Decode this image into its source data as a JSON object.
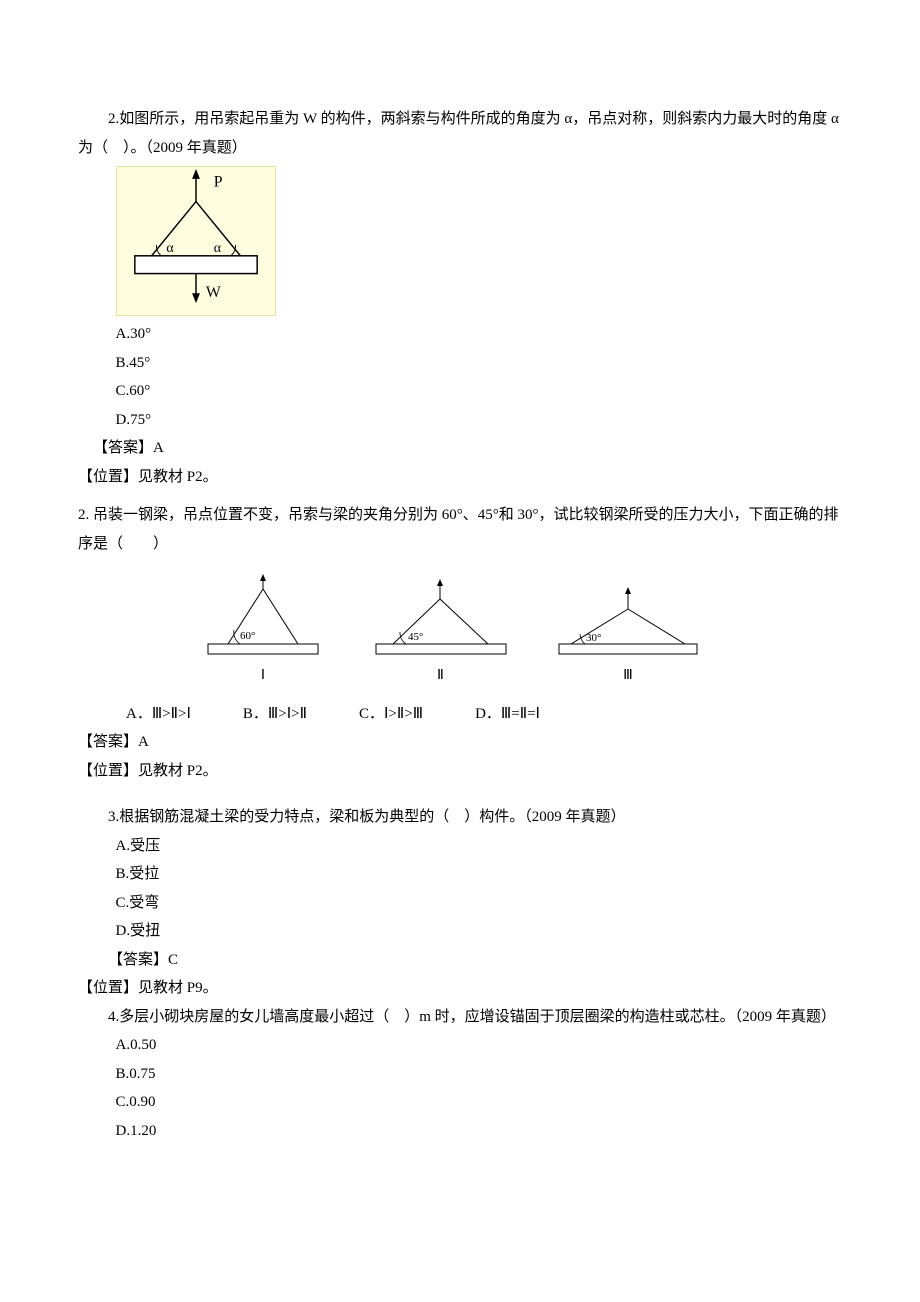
{
  "q2a": {
    "text": "2.如图所示，用吊索起吊重为 W 的构件，两斜索与构件所成的角度为 α，吊点对称，则斜索内力最大时的角度 α 为（　）。（2009 年真题）",
    "optA": "A.30°",
    "optB": "B.45°",
    "optC": "C.60°",
    "optD": "D.75°",
    "answer": "【答案】A",
    "position": "【位置】见教材 P2。",
    "fig": {
      "labelP": "P",
      "labelAlphaL": "α",
      "labelAlphaR": "α",
      "labelW": "W"
    }
  },
  "q2b": {
    "text": "2. 吊装一钢梁，吊点位置不变，吊索与梁的夹角分别为 60°、45°和 30°，试比较钢梁所受的压力大小，下面正确的排序是（　　）",
    "figs": {
      "angle1": "60°",
      "label1": "Ⅰ",
      "angle2": "45°",
      "label2": "Ⅱ",
      "angle3": "30°",
      "label3": "Ⅲ"
    },
    "optA": "A．Ⅲ>Ⅱ>Ⅰ",
    "optB": "B．Ⅲ>Ⅰ>Ⅱ",
    "optC": "C．Ⅰ>Ⅱ>Ⅲ",
    "optD": "D．Ⅲ=Ⅱ=Ⅰ",
    "answer": "【答案】A",
    "position": "【位置】见教材 P2。"
  },
  "q3": {
    "text": "3.根据钢筋混凝土梁的受力特点，梁和板为典型的（　）构件。（2009 年真题）",
    "optA": "A.受压",
    "optB": "B.受拉",
    "optC": "C.受弯",
    "optD": "D.受扭",
    "answer": "【答案】C",
    "position": "【位置】见教材 P9。"
  },
  "q4": {
    "text": "4.多层小砌块房屋的女儿墙高度最小超过（　）m 时，应增设锚固于顶层圈梁的构造柱或芯柱。（2009 年真题）",
    "optA": "A.0.50",
    "optB": "B.0.75",
    "optC": "C.0.90",
    "optD": "D.1.20"
  }
}
